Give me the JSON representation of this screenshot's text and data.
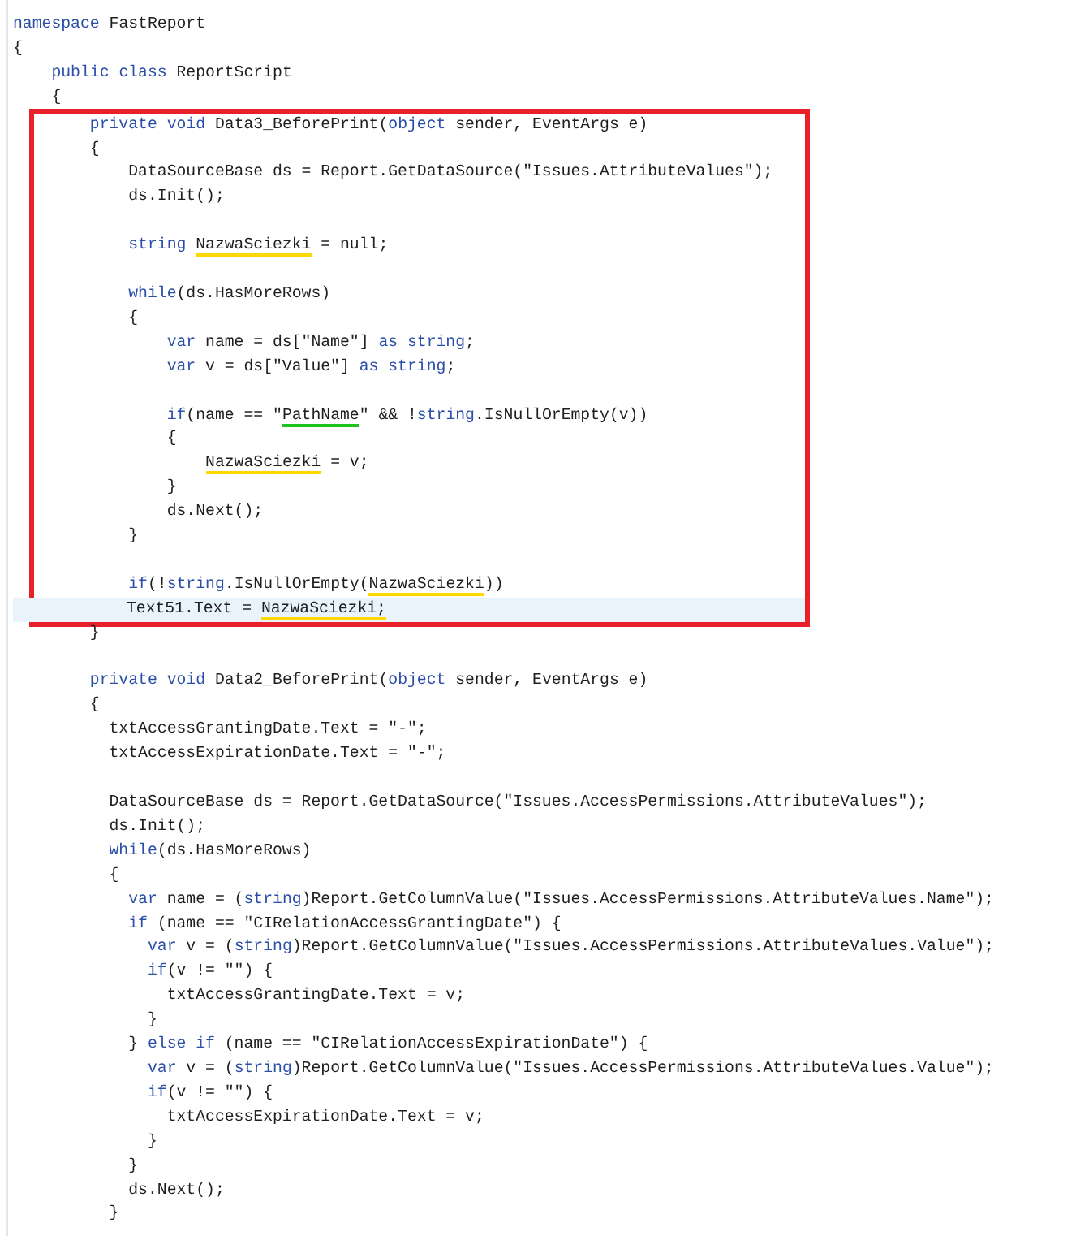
{
  "sections": [
    {
      "boxed": false,
      "lines": [
        {
          "current": false,
          "segments": [
            {
              "text": "namespace",
              "kind": "keyword"
            },
            {
              "text": " FastReport",
              "kind": "plain"
            }
          ]
        },
        {
          "current": false,
          "segments": [
            {
              "text": "{",
              "kind": "plain"
            }
          ]
        },
        {
          "current": false,
          "segments": [
            {
              "text": "    public ",
              "kind": "keyword"
            },
            {
              "text": "class",
              "kind": "keyword"
            },
            {
              "text": " ReportScript",
              "kind": "plain"
            }
          ]
        },
        {
          "current": false,
          "segments": [
            {
              "text": "    {",
              "kind": "plain"
            }
          ]
        }
      ]
    },
    {
      "boxed": true,
      "lines": [
        {
          "current": false,
          "segments": [
            {
              "text": "        private ",
              "kind": "keyword"
            },
            {
              "text": "void",
              "kind": "keyword"
            },
            {
              "text": " Data3_BeforePrint(",
              "kind": "plain"
            },
            {
              "text": "object",
              "kind": "keyword"
            },
            {
              "text": " sender, EventArgs e)",
              "kind": "plain"
            }
          ]
        },
        {
          "current": false,
          "segments": [
            {
              "text": "        {",
              "kind": "plain"
            }
          ]
        },
        {
          "current": false,
          "segments": [
            {
              "text": "            DataSourceBase ds = Report.GetDataSource(\"Issues.AttributeValues\");",
              "kind": "plain"
            }
          ]
        },
        {
          "current": false,
          "segments": [
            {
              "text": "            ds.Init();",
              "kind": "plain"
            }
          ]
        },
        {
          "current": false
        },
        {
          "current": false,
          "segments": [
            {
              "text": "            string ",
              "kind": "keyword"
            },
            {
              "text": "NazwaSciezki",
              "kind": "marked",
              "color": "#ffd800"
            },
            {
              "text": " = null;",
              "kind": "plain"
            }
          ]
        },
        {
          "current": false
        },
        {
          "current": false,
          "segments": [
            {
              "text": "            while",
              "kind": "keyword"
            },
            {
              "text": "(ds.HasMoreRows)",
              "kind": "plain"
            }
          ]
        },
        {
          "current": false,
          "segments": [
            {
              "text": "            {",
              "kind": "plain"
            }
          ]
        },
        {
          "current": false,
          "segments": [
            {
              "text": "                var",
              "kind": "keyword"
            },
            {
              "text": " name = ds[\"Name\"] ",
              "kind": "plain"
            },
            {
              "text": "as string",
              "kind": "keyword"
            },
            {
              "text": ";",
              "kind": "plain"
            }
          ]
        },
        {
          "current": false,
          "segments": [
            {
              "text": "                var",
              "kind": "keyword"
            },
            {
              "text": " v = ds[\"Value\"] ",
              "kind": "plain"
            },
            {
              "text": "as string",
              "kind": "keyword"
            },
            {
              "text": ";",
              "kind": "plain"
            }
          ]
        },
        {
          "current": false
        },
        {
          "current": false,
          "segments": [
            {
              "text": "                if",
              "kind": "keyword"
            },
            {
              "text": "(name == \"",
              "kind": "plain"
            },
            {
              "text": "PathName",
              "kind": "marked",
              "color": "#1ec21e"
            },
            {
              "text": "\" && !",
              "kind": "plain"
            },
            {
              "text": "string",
              "kind": "keyword"
            },
            {
              "text": ".IsNullOrEmpty(v))",
              "kind": "plain"
            }
          ]
        },
        {
          "current": false,
          "segments": [
            {
              "text": "                {",
              "kind": "plain"
            }
          ]
        },
        {
          "current": false,
          "segments": [
            {
              "text": "                    NazwaSciezki",
              "kind": "marked",
              "color": "#ffd800"
            },
            {
              "text": " = v;",
              "kind": "plain"
            }
          ]
        },
        {
          "current": false,
          "segments": [
            {
              "text": "                }",
              "kind": "plain"
            }
          ]
        },
        {
          "current": false,
          "segments": [
            {
              "text": "                ds.Next();",
              "kind": "plain"
            }
          ]
        },
        {
          "current": false,
          "segments": [
            {
              "text": "            }",
              "kind": "plain"
            }
          ]
        },
        {
          "current": false
        },
        {
          "current": false,
          "segments": [
            {
              "text": "            if",
              "kind": "keyword"
            },
            {
              "text": "(!",
              "kind": "plain"
            },
            {
              "text": "string",
              "kind": "keyword"
            },
            {
              "text": ".IsNullOrEmpty(",
              "kind": "plain"
            },
            {
              "text": "NazwaSciezki",
              "kind": "marked",
              "color": "#ffd800"
            },
            {
              "text": "))",
              "kind": "plain"
            }
          ]
        },
        {
          "current": true,
          "segments": [
            {
              "text": "              Text51.Text = ",
              "kind": "plain"
            },
            {
              "text": "NazwaSciezki;",
              "kind": "marked",
              "color": "#ffd800"
            }
          ]
        }
      ]
    },
    {
      "boxed": false,
      "lines": [
        {
          "current": false,
          "segments": [
            {
              "text": "        }",
              "kind": "plain"
            }
          ]
        },
        {
          "current": false
        },
        {
          "current": false,
          "segments": [
            {
              "text": "        private ",
              "kind": "keyword"
            },
            {
              "text": "void",
              "kind": "keyword"
            },
            {
              "text": " Data2_BeforePrint(",
              "kind": "plain"
            },
            {
              "text": "object",
              "kind": "keyword"
            },
            {
              "text": " sender, EventArgs e)",
              "kind": "plain"
            }
          ]
        },
        {
          "current": false,
          "segments": [
            {
              "text": "        {",
              "kind": "plain"
            }
          ]
        },
        {
          "current": false,
          "segments": [
            {
              "text": "          txtAccessGrantingDate.Text = \"-\";",
              "kind": "plain"
            }
          ]
        },
        {
          "current": false,
          "segments": [
            {
              "text": "          txtAccessExpirationDate.Text = \"-\";",
              "kind": "plain"
            }
          ]
        },
        {
          "current": false
        },
        {
          "current": false,
          "segments": [
            {
              "text": "          DataSourceBase ds = Report.GetDataSource(\"Issues.AccessPermissions.AttributeValues\");",
              "kind": "plain"
            }
          ]
        },
        {
          "current": false,
          "segments": [
            {
              "text": "          ds.Init();",
              "kind": "plain"
            }
          ]
        },
        {
          "current": false,
          "segments": [
            {
              "text": "          while",
              "kind": "keyword"
            },
            {
              "text": "(ds.HasMoreRows)",
              "kind": "plain"
            }
          ]
        },
        {
          "current": false,
          "segments": [
            {
              "text": "          {",
              "kind": "plain"
            }
          ]
        },
        {
          "current": false,
          "segments": [
            {
              "text": "            var",
              "kind": "keyword"
            },
            {
              "text": " name = (",
              "kind": "plain"
            },
            {
              "text": "string",
              "kind": "keyword"
            },
            {
              "text": ")Report.GetColumnValue(\"Issues.AccessPermissions.AttributeValues.Name\");",
              "kind": "plain"
            }
          ]
        },
        {
          "current": false,
          "segments": [
            {
              "text": "            if",
              "kind": "keyword"
            },
            {
              "text": " (name == \"CIRelationAccessGrantingDate\") {",
              "kind": "plain"
            }
          ]
        },
        {
          "current": false,
          "segments": [
            {
              "text": "              var",
              "kind": "keyword"
            },
            {
              "text": " v = (",
              "kind": "plain"
            },
            {
              "text": "string",
              "kind": "keyword"
            },
            {
              "text": ")Report.GetColumnValue(\"Issues.AccessPermissions.AttributeValues.Value\");",
              "kind": "plain"
            }
          ]
        },
        {
          "current": false,
          "segments": [
            {
              "text": "              if",
              "kind": "keyword"
            },
            {
              "text": "(v != \"\") {",
              "kind": "plain"
            }
          ]
        },
        {
          "current": false,
          "segments": [
            {
              "text": "                txtAccessGrantingDate.Text = v;",
              "kind": "plain"
            }
          ]
        },
        {
          "current": false,
          "segments": [
            {
              "text": "              }",
              "kind": "plain"
            }
          ]
        },
        {
          "current": false,
          "segments": [
            {
              "text": "            } ",
              "kind": "plain"
            },
            {
              "text": "else if",
              "kind": "keyword"
            },
            {
              "text": " (name == \"CIRelationAccessExpirationDate\") {",
              "kind": "plain"
            }
          ]
        },
        {
          "current": false,
          "segments": [
            {
              "text": "              var",
              "kind": "keyword"
            },
            {
              "text": " v = (",
              "kind": "plain"
            },
            {
              "text": "string",
              "kind": "keyword"
            },
            {
              "text": ")Report.GetColumnValue(\"Issues.AccessPermissions.AttributeValues.Value\");",
              "kind": "plain"
            }
          ]
        },
        {
          "current": false,
          "segments": [
            {
              "text": "              if",
              "kind": "keyword"
            },
            {
              "text": "(v != \"\") {",
              "kind": "plain"
            }
          ]
        },
        {
          "current": false,
          "segments": [
            {
              "text": "                txtAccessExpirationDate.Text = v;",
              "kind": "plain"
            }
          ]
        },
        {
          "current": false,
          "segments": [
            {
              "text": "              }",
              "kind": "plain"
            }
          ]
        },
        {
          "current": false,
          "segments": [
            {
              "text": "            }",
              "kind": "plain"
            }
          ]
        },
        {
          "current": false,
          "segments": [
            {
              "text": "            ds.Next();",
              "kind": "plain"
            }
          ]
        },
        {
          "current": false,
          "segments": [
            {
              "text": "          }",
              "kind": "plain"
            }
          ]
        }
      ]
    }
  ]
}
